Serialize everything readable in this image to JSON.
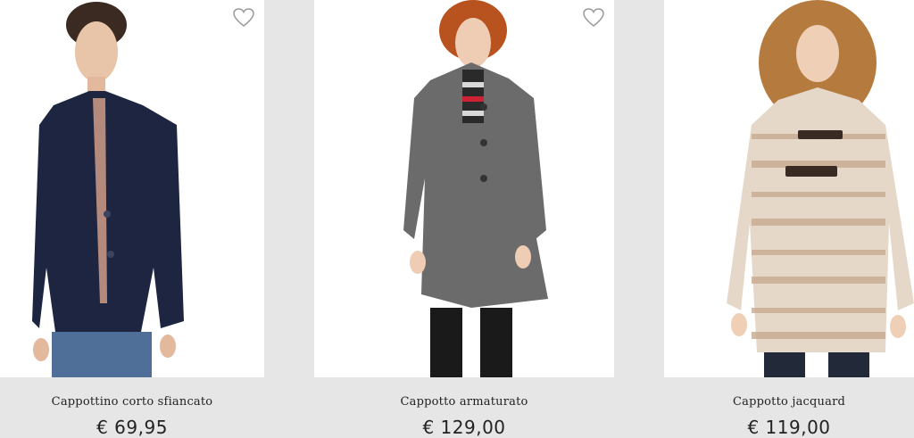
{
  "products": [
    {
      "name": "Cappottino corto sfiancato",
      "price": "€ 69,95",
      "wishlist_icon": "heart-outline-icon",
      "image_alt": "Navy short fitted coat"
    },
    {
      "name": "Cappotto armaturato",
      "price": "€ 129,00",
      "wishlist_icon": "heart-outline-icon",
      "image_alt": "Grey textured coat"
    },
    {
      "name": "Cappotto jacquard",
      "price": "€ 119,00",
      "image_alt": "Jacquard toggle coat"
    }
  ],
  "colors": {
    "accent": "#2e9e3e",
    "background": "#e6e6e6",
    "card": "#ffffff"
  }
}
